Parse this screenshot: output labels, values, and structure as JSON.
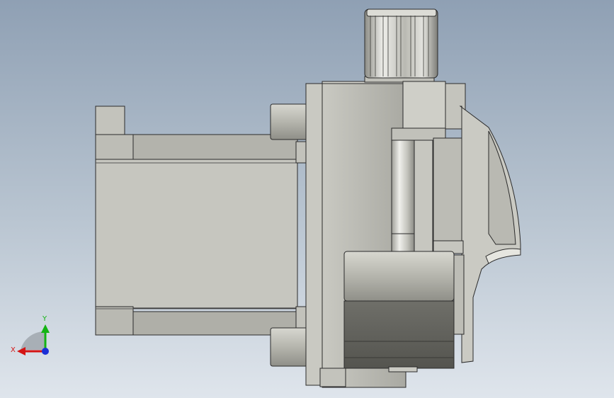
{
  "viewport": {
    "background_top": "#8fa0b4",
    "background_bottom": "#dfe5ec"
  },
  "model": {
    "part_color": "#c8c8c1",
    "edge_color": "#2b2b2b",
    "shaft_color": "#d4d4cc"
  },
  "triad": {
    "x_label": "X",
    "y_label": "Y",
    "x_color": "#d41414",
    "y_color": "#13b313",
    "z_color": "#1c2fd6"
  }
}
